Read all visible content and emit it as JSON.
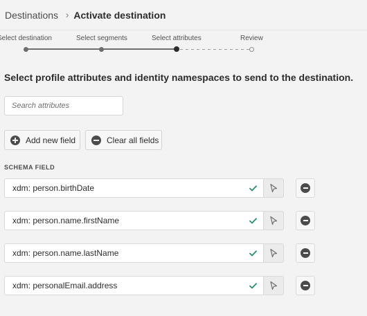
{
  "breadcrumb": {
    "parent": "Destinations",
    "separator": "›",
    "current": "Activate destination"
  },
  "steps": [
    {
      "label": "Select destination",
      "state": "done"
    },
    {
      "label": "Select segments",
      "state": "done"
    },
    {
      "label": "Select attributes",
      "state": "current"
    },
    {
      "label": "Review",
      "state": "todo"
    }
  ],
  "main": {
    "heading": "Select profile attributes and identity namespaces to send to the destination.",
    "search": {
      "placeholder": "Search attributes",
      "value": ""
    },
    "add_button": "Add new field",
    "clear_button": "Clear all fields",
    "schema_label": "SCHEMA FIELD",
    "fields": [
      {
        "value": "xdm: person.birthDate",
        "valid": true
      },
      {
        "value": "xdm: person.name.firstName",
        "valid": true
      },
      {
        "value": "xdm: person.name.lastName",
        "valid": true
      },
      {
        "value": "xdm: personalEmail.address",
        "valid": true
      }
    ]
  },
  "icons": {
    "check": "checkmark-icon",
    "picker": "select-cursor-icon",
    "remove": "remove-circle-icon",
    "add": "add-circle-icon",
    "clear": "remove-circle-icon"
  },
  "colors": {
    "check": "#268e6c",
    "icon": "#4b4b4b",
    "background": "#f3f3f3"
  }
}
